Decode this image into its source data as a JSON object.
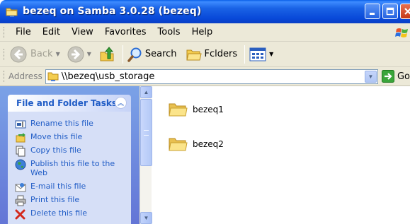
{
  "window": {
    "title": "bezeq on Samba 3.0.28 (bezeq)",
    "controls": {
      "minimize_icon": "minimize-icon",
      "maximize_icon": "maximize-icon",
      "close_icon": "close-icon"
    }
  },
  "menubar": {
    "items": [
      "File",
      "Edit",
      "View",
      "Favorites",
      "Tools",
      "Help"
    ]
  },
  "toolbar": {
    "back_label": "Back",
    "search_label": "Search",
    "folders_label": "Fclders"
  },
  "address": {
    "label": "Address",
    "value": "\\\\bezeq\\usb_storage",
    "go_label": "Go"
  },
  "tasks": {
    "title": "File and Folder Tasks",
    "items": [
      {
        "label": "Rename this file",
        "icon": "rename-icon"
      },
      {
        "label": "Move this file",
        "icon": "move-icon"
      },
      {
        "label": "Copy this file",
        "icon": "copy-icon"
      },
      {
        "label": "Publish this file to the Web",
        "icon": "publish-web-icon"
      },
      {
        "label": "E-mail this file",
        "icon": "email-icon"
      },
      {
        "label": "Print this file",
        "icon": "print-icon"
      },
      {
        "label": "Delete this file",
        "icon": "delete-icon"
      }
    ]
  },
  "folders": [
    {
      "name": "bezeq1"
    },
    {
      "name": "bezeq2"
    }
  ],
  "colors": {
    "title_bar": "#0a5fe8",
    "task_pane": "#7ba2e7",
    "task_link": "#215dc6",
    "menu_bg": "#ece9d8"
  }
}
